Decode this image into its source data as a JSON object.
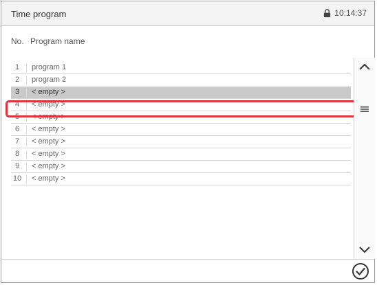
{
  "app": {
    "title": "Time program",
    "time": "10:14:37"
  },
  "table": {
    "col_no": "No.",
    "col_name": "Program name",
    "rows": [
      {
        "no": "1",
        "name": "program 1"
      },
      {
        "no": "2",
        "name": "program 2"
      },
      {
        "no": "3",
        "name": "< empty >"
      },
      {
        "no": "4",
        "name": "< empty >"
      },
      {
        "no": "5",
        "name": "< empty >"
      },
      {
        "no": "6",
        "name": "< empty >"
      },
      {
        "no": "7",
        "name": "< empty >"
      },
      {
        "no": "8",
        "name": "< empty >"
      },
      {
        "no": "9",
        "name": "< empty >"
      },
      {
        "no": "10",
        "name": "< empty >"
      }
    ],
    "selected_row": "3"
  },
  "icons": {
    "status": "lock-icon",
    "scroll_up": "chevron-up-icon",
    "scroll_handle": "scroll-handle-icon",
    "scroll_down": "chevron-down-icon",
    "confirm": "checkmark-circle-icon"
  },
  "colors": {
    "selection": "#c9c9c9",
    "highlight_border": "#e0353d"
  }
}
